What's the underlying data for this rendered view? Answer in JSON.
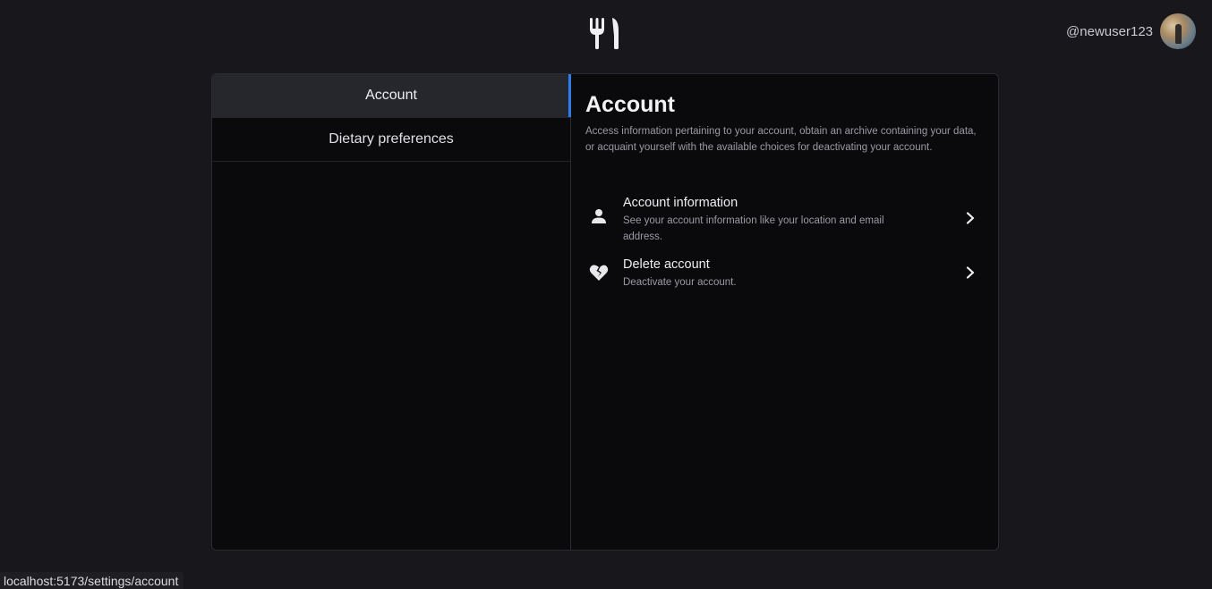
{
  "header": {
    "logo_icon": "fork-knife-icon",
    "username": "@newuser123",
    "avatar_icon": "user-avatar"
  },
  "sidebar": {
    "items": [
      {
        "label": "Account",
        "active": true
      },
      {
        "label": "Dietary preferences",
        "active": false
      }
    ]
  },
  "main": {
    "title": "Account",
    "description": "Access information pertaining to your account, obtain an archive containing your data, or acquaint yourself with the available choices for deactivating your account.",
    "options": [
      {
        "icon": "person-icon",
        "title": "Account information",
        "subtitle": "See your account information like your location and email address."
      },
      {
        "icon": "broken-heart-icon",
        "title": "Delete account",
        "subtitle": "Deactivate your account."
      }
    ]
  },
  "status_bar": {
    "url": "localhost:5173/settings/account"
  },
  "colors": {
    "background": "#18181c",
    "panel": "#0a0a0d",
    "accent": "#2f7ce8"
  }
}
